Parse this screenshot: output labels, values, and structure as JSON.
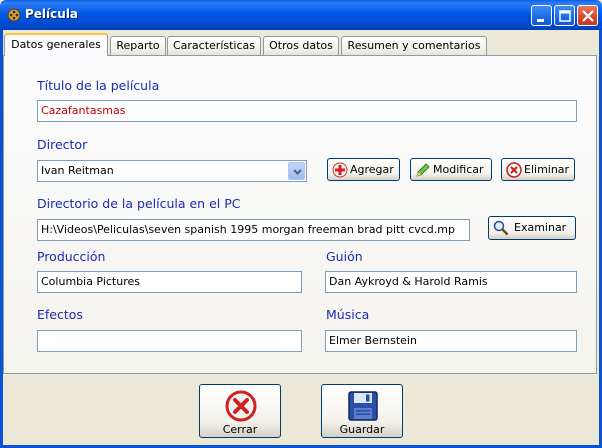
{
  "window": {
    "title": "Película"
  },
  "tabs": [
    {
      "label": "Datos generales"
    },
    {
      "label": "Reparto"
    },
    {
      "label": "Características"
    },
    {
      "label": "Otros datos"
    },
    {
      "label": "Resumen y comentarios"
    }
  ],
  "form": {
    "titulo_label": "Título de la película",
    "titulo_value": "Cazafantasmas",
    "director_label": "Director",
    "director_value": "Ivan Reitman",
    "directorio_label": "Directorio de la película en el PC",
    "directorio_value": "H:\\Videos\\Peliculas\\seven spanish 1995 morgan freeman brad pitt cvcd.mp",
    "produccion_label": "Producción",
    "produccion_value": "Columbia Pictures",
    "guion_label": "Guión",
    "guion_value": "Dan Aykroyd & Harold Ramis",
    "efectos_label": "Efectos",
    "efectos_value": "",
    "musica_label": "Música",
    "musica_value": "Elmer Bernstein"
  },
  "buttons": {
    "agregar": "Agregar",
    "modificar": "Modificar",
    "eliminar": "Eliminar",
    "examinar": "Examinar",
    "cerrar": "Cerrar",
    "guardar": "Guardar"
  },
  "colors": {
    "label_blue": "#1A2CB0",
    "title_red": "#C00000",
    "titlebar_blue": "#0058E6"
  }
}
